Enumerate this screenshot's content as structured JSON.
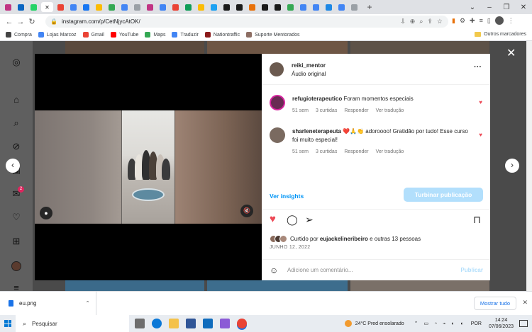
{
  "browser": {
    "tab_colors": [
      "#c13584",
      "#0a66c2",
      "#25d366",
      "#ffffff",
      "#ea4335",
      "#4285f4",
      "#1877f2",
      "#fbbc04",
      "#34a853",
      "#4285f4",
      "#9aa0a6",
      "#c13584",
      "#4285f4",
      "#ea4335",
      "#0f9d58",
      "#fbbc04",
      "#1da1f2",
      "#1a1a1a",
      "#1a1a1a",
      "#e8710a",
      "#1a1a1a",
      "#1a1a1a",
      "#34a853",
      "#4285f4",
      "#4285f4",
      "#1e88e5",
      "#4285f4",
      "#9aa0a6"
    ],
    "url": "instagram.com/p/CetNjycAtOK/",
    "bookmarks": [
      {
        "label": "Compra",
        "color": "#444444"
      },
      {
        "label": "Lojas Marcoz",
        "color": "#4285f4"
      },
      {
        "label": "Gmail",
        "color": "#ea4335"
      },
      {
        "label": "YouTube",
        "color": "#ff0000"
      },
      {
        "label": "Maps",
        "color": "#34a853"
      },
      {
        "label": "Traduzir",
        "color": "#4285f4"
      },
      {
        "label": "Nationtraffic",
        "color": "#8b1a1a"
      },
      {
        "label": "Suporte Mentorados",
        "color": "#8d6e63"
      }
    ],
    "other_bookmarks": "Outros marcadores"
  },
  "post": {
    "username": "reiki_mentor",
    "audio": "Áudio original",
    "comments": [
      {
        "user": "refugioterapeutico",
        "text": "Foram momentos especiais",
        "time": "51 sem",
        "likes": "3 curtidas",
        "reply": "Responder",
        "translate": "Ver tradução"
      },
      {
        "user": "sharleneterapeuta",
        "text": "❤️🙏👏 adoroooo! Gratidão por tudo! Esse curso foi muito especial!",
        "time": "51 sem",
        "likes": "3 curtidas",
        "reply": "Responder",
        "translate": "Ver tradução"
      }
    ],
    "insights": "Ver insights",
    "boost": "Turbinar publicação",
    "liked_by_prefix": "Curtido por",
    "liked_by_user": "eujackelineribeiro",
    "liked_by_suffix": "e outras 13 pessoas",
    "date": "JUNHO 12, 2022",
    "comment_placeholder": "Adicione um comentário...",
    "publish": "Publicar"
  },
  "sidebar": {
    "notification_count": "2"
  },
  "downloads": {
    "file": "eu.png",
    "show_all": "Mostrar tudo"
  },
  "taskbar": {
    "search": "Pesquisar",
    "weather": "24°C Pred ensolarado",
    "lang": "POR",
    "time": "14:24",
    "date": "07/06/2023"
  },
  "colors": {
    "accent": "#0095f6",
    "heart": "#ed4956",
    "boost_disabled": "#b2dffc"
  }
}
